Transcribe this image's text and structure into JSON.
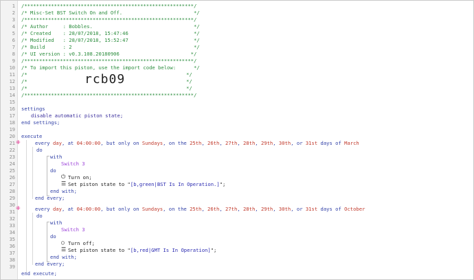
{
  "line_numbers": [
    "1",
    "2",
    "3",
    "4",
    "5",
    "6",
    "7",
    "8",
    "9",
    "10",
    "11",
    "12",
    "13",
    "14",
    "15",
    "16",
    "17",
    "18",
    "19",
    "20",
    "21",
    "22",
    "23",
    "24",
    "25",
    "26",
    "27",
    "28",
    "29",
    "30",
    "31",
    "32",
    "33",
    "34",
    "35",
    "36",
    "37",
    "38",
    "39"
  ],
  "header": {
    "stars": "/*********************************************************/",
    "title": "/* Misc-Set BST Switch On and Off.                        */",
    "author": "/* Author     : Bobbles.                                  */",
    "created": "/* Created    : 28/07/2018, 15:47:46                      */",
    "modified": "/* Modified   : 28/07/2018, 15:52:47                      */",
    "build": "/* Build      : 2                                         */",
    "ui_version": "/* UI version : v0.3.108.20180906                        */",
    "import_note": "/* To import this piston, use the import code below:      */",
    "blank_open": "/*",
    "blank_close": "*/",
    "import_code": "rcb09"
  },
  "settings": {
    "open": "settings",
    "line": "disable automatic piston state;",
    "close": "end settings;"
  },
  "execute": {
    "open": "execute",
    "close": "end execute;"
  },
  "blocks": [
    {
      "every_prefix": "every ",
      "every_unit": "day",
      "at_text": ", at ",
      "time": "04:00:00",
      "only_text": ", but only on ",
      "weekday": "Sundays",
      "on_text": ", on the ",
      "d1": "25th",
      "d2": "26th",
      "d3": "27th",
      "d4": "28th",
      "d5": "29th",
      "d6": "30th",
      "or_text": ", or ",
      "d7": "31st",
      "days_of": " days of ",
      "month": "March",
      "do": "do",
      "with": "with",
      "device": "Switch 3",
      "do2": "do",
      "action1": "Turn on;",
      "action2_prefix": "Set piston state to \"",
      "action2_value": "[b,green|BST Is In Operation.]",
      "action2_suffix": "\";",
      "end_with": "end with;",
      "end_every": "end every;"
    },
    {
      "every_prefix": "every ",
      "every_unit": "day",
      "at_text": ", at ",
      "time": "04:00:00",
      "only_text": ", but only on ",
      "weekday": "Sundays",
      "on_text": ", on the ",
      "d1": "25th",
      "d2": "26th",
      "d3": "27th",
      "d4": "28th",
      "d5": "29th",
      "d6": "30th",
      "or_text": ", or ",
      "d7": "31st",
      "days_of": " days of ",
      "month": "October",
      "do": "do",
      "with": "with",
      "device": "Switch 3",
      "do2": "do",
      "action1": "Turn off;",
      "action2_prefix": "Set piston state to \"",
      "action2_value": "[b,red|GMT Is In Operation]",
      "action2_suffix": "\";",
      "end_with": "end with;",
      "end_every": "end every;"
    }
  ],
  "icons": {
    "power": "power-icon",
    "pin": "pin-icon",
    "state": "list-icon"
  },
  "colors": {
    "comment": "#2a8c3c",
    "keyword": "#2f3fa6",
    "device": "#9a3fd8",
    "value": "#c0392b"
  }
}
